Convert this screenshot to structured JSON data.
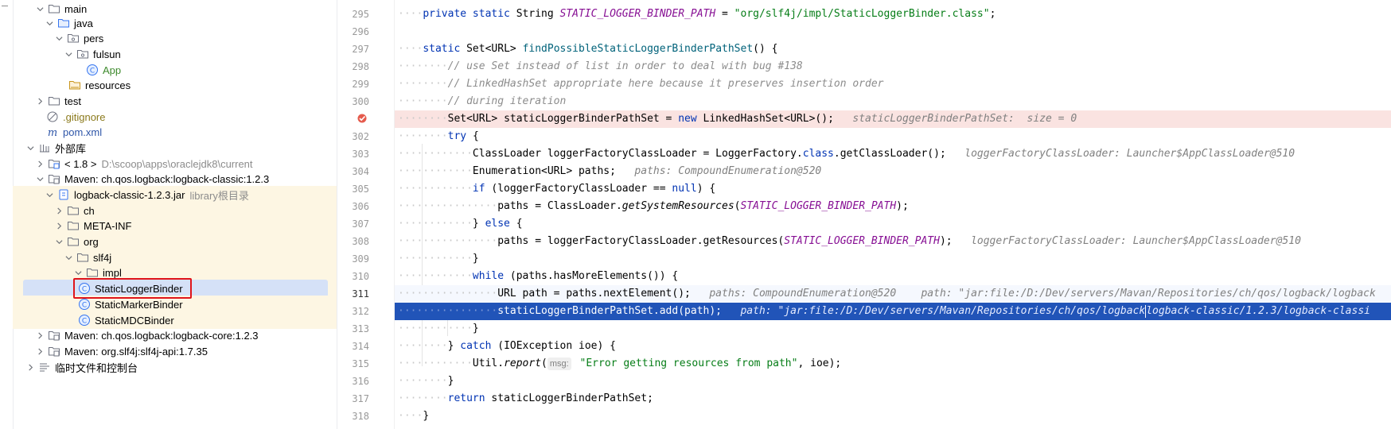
{
  "colors": {
    "selection_bg": "#d5e1f7",
    "library_bg": "#fdf6e3",
    "breakpoint_line": "#fae3e1",
    "exec_line": "#2154b8",
    "highlight_box": "#e0141a",
    "keyword": "#0033b3",
    "string": "#067d17",
    "constant": "#871094",
    "comment": "#8c8c8c"
  },
  "tree": {
    "items": [
      {
        "label": "main",
        "sub": "",
        "icon": "folder-icon"
      },
      {
        "label": "java",
        "sub": "",
        "icon": "source-folder-icon"
      },
      {
        "label": "pers",
        "sub": "",
        "icon": "package-icon"
      },
      {
        "label": "fulsun",
        "sub": "",
        "icon": "package-icon"
      },
      {
        "label": "App",
        "sub": "",
        "icon": "class-icon"
      },
      {
        "label": "resources",
        "sub": "",
        "icon": "resources-folder-icon"
      },
      {
        "label": "test",
        "sub": "",
        "icon": "folder-icon"
      },
      {
        "label": ".gitignore",
        "sub": "",
        "icon": "ignore-file-icon"
      },
      {
        "label": "pom.xml",
        "sub": "",
        "icon": "maven-icon"
      },
      {
        "label": "外部库",
        "sub": "",
        "icon": "libraries-icon"
      },
      {
        "label": "< 1.8 >",
        "sub": "D:\\scoop\\apps\\oraclejdk8\\current",
        "icon": "jdk-icon"
      },
      {
        "label": "Maven: ch.qos.logback:logback-classic:1.2.3",
        "sub": "",
        "icon": "library-icon"
      },
      {
        "label": "logback-classic-1.2.3.jar",
        "sub": "library根目录",
        "icon": "jar-icon"
      },
      {
        "label": "ch",
        "sub": "",
        "icon": "folder-icon"
      },
      {
        "label": "META-INF",
        "sub": "",
        "icon": "folder-icon"
      },
      {
        "label": "org",
        "sub": "",
        "icon": "folder-icon"
      },
      {
        "label": "slf4j",
        "sub": "",
        "icon": "folder-icon"
      },
      {
        "label": "impl",
        "sub": "",
        "icon": "folder-icon"
      },
      {
        "label": "StaticLoggerBinder",
        "sub": "",
        "icon": "class-icon"
      },
      {
        "label": "StaticMarkerBinder",
        "sub": "",
        "icon": "class-icon"
      },
      {
        "label": "StaticMDCBinder",
        "sub": "",
        "icon": "class-icon"
      },
      {
        "label": "Maven: ch.qos.logback:logback-core:1.2.3",
        "sub": "",
        "icon": "library-icon"
      },
      {
        "label": "Maven: org.slf4j:slf4j-api:1.7.35",
        "sub": "",
        "icon": "library-icon"
      },
      {
        "label": "临时文件和控制台",
        "sub": "",
        "icon": "scratches-icon"
      }
    ]
  },
  "editor": {
    "line_numbers": [
      "295",
      "296",
      "297",
      "298",
      "299",
      "300",
      "",
      "302",
      "303",
      "304",
      "305",
      "306",
      "307",
      "308",
      "309",
      "310",
      "311",
      "312",
      "313",
      "314",
      "315",
      "316",
      "317",
      "318"
    ],
    "code": {
      "l295": {
        "a": "private static ",
        "b": "String ",
        "c": "STATIC_LOGGER_BINDER_PATH",
        "d": " = ",
        "e": "\"org/slf4j/impl/StaticLoggerBinder.class\"",
        "f": ";"
      },
      "l297": {
        "a": "static ",
        "b": "Set<URL> ",
        "c": "findPossibleStaticLoggerBinderPathSet",
        "d": "() {"
      },
      "l298": "// use Set instead of list in order to deal with bug #138",
      "l299": "// LinkedHashSet appropriate here because it preserves insertion order",
      "l300": "// during iteration",
      "l301": {
        "a": "Set<URL> staticLoggerBinderPathSet = ",
        "b": "new ",
        "c": "LinkedHashSet<URL>();",
        "inl": "staticLoggerBinderPathSet:  size = 0"
      },
      "l302": {
        "a": "try ",
        "b": "{"
      },
      "l303": {
        "a": "ClassLoader loggerFactoryClassLoader = LoggerFactory.",
        "b": "class",
        "c": ".getClassLoader();",
        "inl": "loggerFactoryClassLoader: Launcher$AppClassLoader@510"
      },
      "l304": {
        "a": "Enumeration<URL> paths;",
        "inl": "paths: CompoundEnumeration@520"
      },
      "l305": {
        "a": "if ",
        "b": "(loggerFactoryClassLoader == ",
        "c": "null",
        "d": ") {"
      },
      "l306": {
        "a": "paths = ClassLoader.",
        "b": "getSystemResources",
        "c": "(",
        "d": "STATIC_LOGGER_BINDER_PATH",
        "e": ");"
      },
      "l307": {
        "a": "} ",
        "b": "else ",
        "c": "{"
      },
      "l308": {
        "a": "paths = loggerFactoryClassLoader.getResources(",
        "b": "STATIC_LOGGER_BINDER_PATH",
        "c": ");",
        "inl": "loggerFactoryClassLoader: Launcher$AppClassLoader@510"
      },
      "l309": "}",
      "l310": {
        "a": "while ",
        "b": "(paths.hasMoreElements()) {"
      },
      "l311": {
        "a": "URL path = paths.nextElement();",
        "inl": "paths: CompoundEnumeration@520    path: \"jar:file:/D:/Dev/servers/Mavan/Repositories/ch/qos/logback/logback"
      },
      "l312": {
        "a": "staticLoggerBinderPathSet.add(path);",
        "inl1": "path: \"jar:file:/D:/Dev/servers/Mavan/Repositories/ch/qos/logback",
        "inl2": "logback-classic/1.2.3/logback-classi"
      },
      "l313": "}",
      "l314": {
        "a": "} ",
        "b": "catch ",
        "c": "(IOException ioe) {"
      },
      "l315": {
        "a": "Util.",
        "b": "report",
        "c": "(",
        "hint": "msg:",
        "d": " \"Error getting resources from path\"",
        "e": ", ioe);"
      },
      "l316": "}",
      "l317": {
        "a": "return ",
        "b": "staticLoggerBinderPathSet;"
      },
      "l318": "}"
    }
  }
}
